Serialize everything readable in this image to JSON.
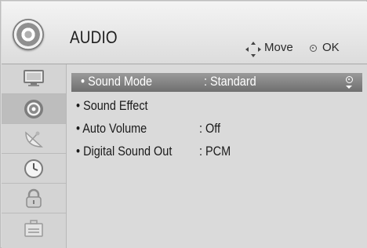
{
  "header": {
    "title": "AUDIO",
    "icon": "speaker-icon",
    "hints": {
      "move_label": "Move",
      "ok_label": "OK"
    }
  },
  "sidebar": {
    "items": [
      {
        "name": "picture-icon",
        "active": false
      },
      {
        "name": "audio-icon",
        "active": true
      },
      {
        "name": "satellite-dish-icon",
        "active": false
      },
      {
        "name": "clock-icon",
        "active": false
      },
      {
        "name": "lock-icon",
        "active": false
      },
      {
        "name": "toolbox-icon",
        "active": false
      }
    ]
  },
  "menu": {
    "items": [
      {
        "label": "• Sound Mode",
        "value": ": Standard",
        "selected": true
      },
      {
        "label": "• Sound Effect",
        "value": ""
      },
      {
        "label": "• Auto Volume",
        "value": ": Off"
      },
      {
        "label": "• Digital Sound Out",
        "value": ": PCM"
      }
    ]
  },
  "colors": {
    "selected_bar": "#808080",
    "panel": "#dadada",
    "header": "#e8e8e8"
  }
}
